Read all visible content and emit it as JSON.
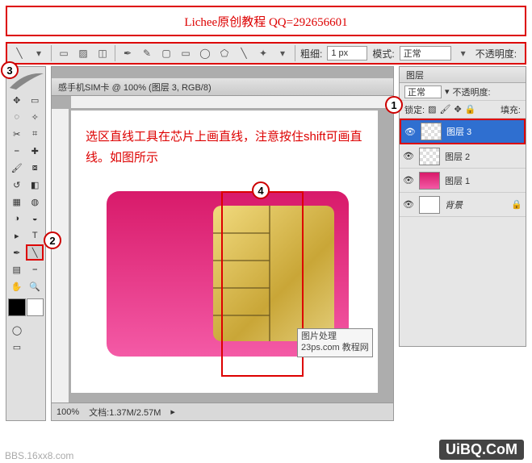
{
  "header": {
    "text": "Lichee原创教程 QQ=292656601"
  },
  "optionsBar": {
    "label_thickness": "粗细:",
    "thickness_value": "1 px",
    "label_mode": "模式:",
    "mode_value": "正常",
    "label_opacity": "不透明度:"
  },
  "callouts": {
    "c1": "1",
    "c2": "2",
    "c3": "3",
    "c4": "4"
  },
  "document": {
    "title": "感手机SIM卡 @ 100% (图层 3, RGB/8)",
    "zoom": "100%",
    "file_size": "文档:1.37M/2.57M"
  },
  "instruction": "选区直线工具在芯片上画直线，注意按住shift可画直线。如图所示",
  "layersPanel": {
    "tab": "图层",
    "blend_mode": "正常",
    "opacity_label": "不透明度:",
    "lock_label": "锁定:",
    "fill_label": "填充:",
    "items": [
      {
        "name": "图层 3",
        "selected": true,
        "thumb": "checker"
      },
      {
        "name": "图层 2",
        "selected": false,
        "thumb": "checker"
      },
      {
        "name": "图层 1",
        "selected": false,
        "thumb": "bg"
      },
      {
        "name": "背景",
        "selected": false,
        "thumb": "wht"
      }
    ]
  },
  "watermark": {
    "line1": "图片处理",
    "line2": "23ps.com 教程网"
  },
  "site": "UiBQ.CoM",
  "corner": "BBS.16xx8.com"
}
